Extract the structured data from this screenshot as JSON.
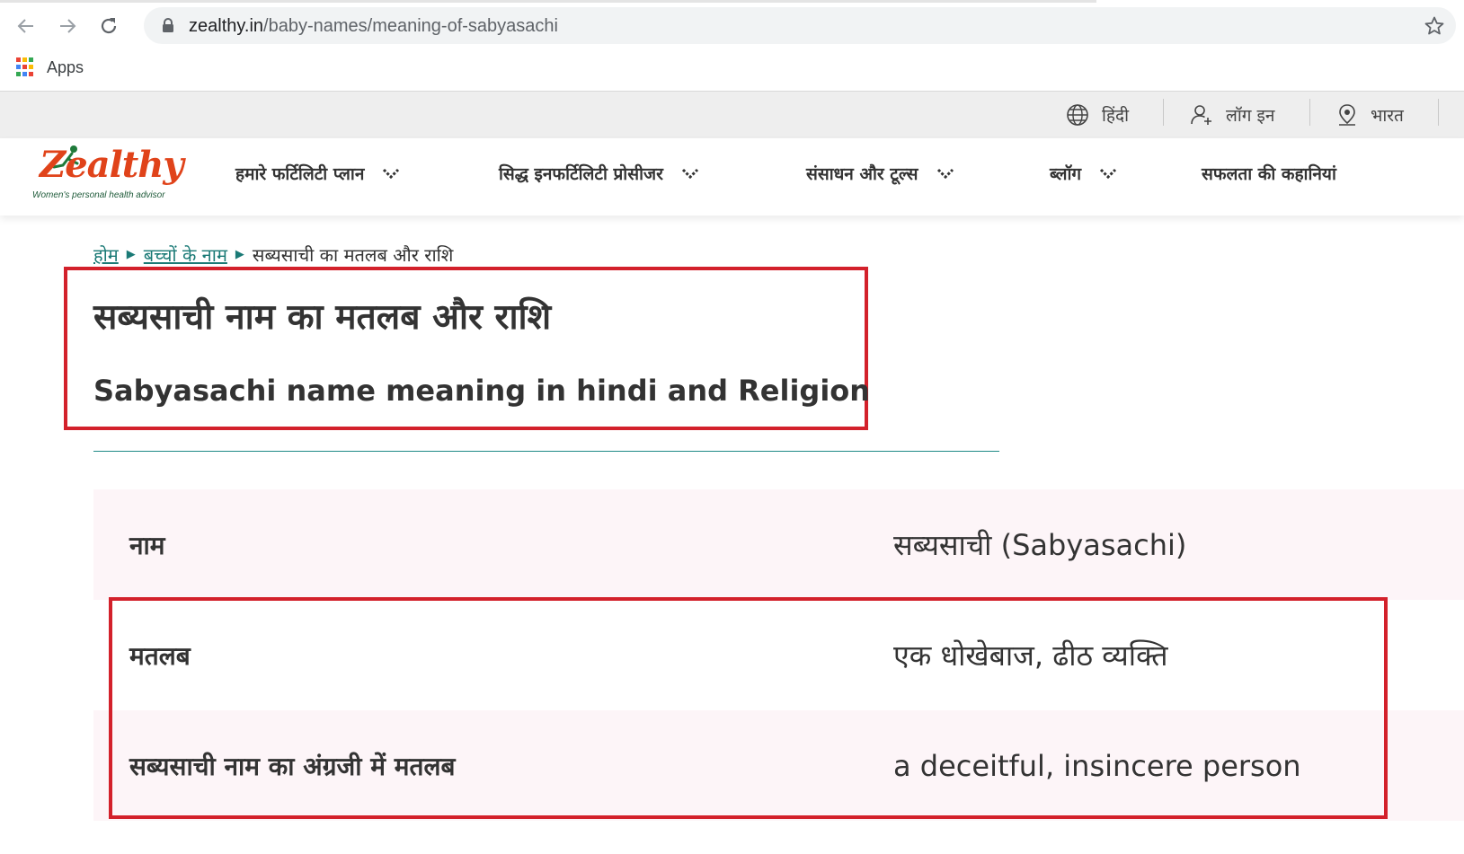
{
  "browser": {
    "url_host": "zealthy.in",
    "url_path": "/baby-names/meaning-of-sabyasachi",
    "bookmarks": {
      "apps_label": "Apps"
    }
  },
  "utility_bar": {
    "language": "हिंदी",
    "login": "लॉग इन",
    "country": "भारत"
  },
  "logo": {
    "wordmark": "Zealthy",
    "tagline": "Women's personal health advisor"
  },
  "nav": {
    "items": [
      {
        "label": "हमारे फर्टिलिटी प्लान",
        "has_dropdown": true
      },
      {
        "label": "सिद्ध इनफर्टिलिटी प्रोसीजर",
        "has_dropdown": true
      },
      {
        "label": "संसाधन और टूल्स",
        "has_dropdown": true
      },
      {
        "label": "ब्लॉग",
        "has_dropdown": true
      },
      {
        "label": "सफलता की कहानियां",
        "has_dropdown": false
      }
    ]
  },
  "breadcrumb": {
    "home": "होम",
    "baby_names": "बच्चों के नाम",
    "current": "सब्यसाची का मतलब और राशि"
  },
  "page": {
    "title": "सब्यसाची नाम का मतलब और राशि",
    "subtitle": "Sabyasachi name meaning in hindi and Religion"
  },
  "table": {
    "rows": [
      {
        "label": "नाम",
        "value": "सब्यसाची (Sabyasachi)"
      },
      {
        "label": "मतलब",
        "value": "एक धोखेबाज, ढीठ व्यक्ति"
      },
      {
        "label": "सब्यसाची नाम का अंग्रजी में मतलब",
        "value": "a deceitful, insincere person"
      }
    ]
  },
  "colors": {
    "accent_teal": "#1a7a76",
    "highlight_red": "#d3212b",
    "row_shade": "#fdf5f8",
    "logo_orange": "#e0431a"
  }
}
